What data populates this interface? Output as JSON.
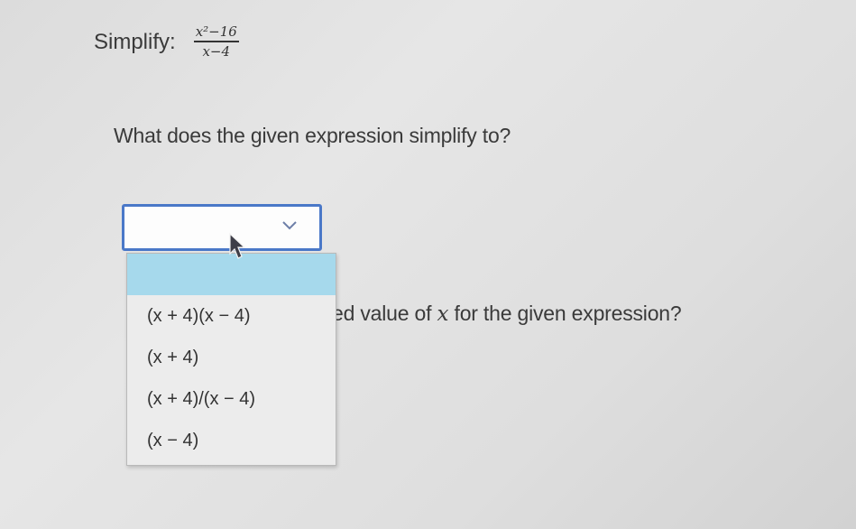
{
  "problem": {
    "prefix": "Simplify:",
    "numerator": "x²−16",
    "denominator": "x−4"
  },
  "question1": "What does the given expression simplify to?",
  "question2": {
    "visible_text_before": "ed value of ",
    "variable": "x",
    "visible_text_after": " for the given expression?"
  },
  "dropdown": {
    "selected": "",
    "options": [
      "",
      "(x + 4)(x − 4)",
      "(x + 4)",
      "(x + 4)/(x − 4)",
      "(x − 4)"
    ],
    "highlighted_index": 0
  },
  "colors": {
    "select_border": "#4a78c8",
    "highlight": "#a6d9ec"
  },
  "icons": {
    "select_arrow": "chevron-down-icon",
    "cursor": "mouse-pointer-icon"
  }
}
